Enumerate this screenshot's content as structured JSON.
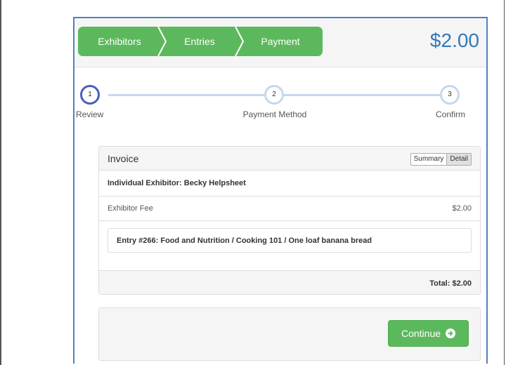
{
  "header": {
    "crumbs": [
      {
        "label": "Exhibitors"
      },
      {
        "label": "Entries"
      },
      {
        "label": "Payment"
      }
    ],
    "total": "$2.00"
  },
  "stepper": {
    "steps": [
      {
        "number": "1",
        "label": "Review",
        "active": true
      },
      {
        "number": "2",
        "label": "Payment Method",
        "active": false
      },
      {
        "number": "3",
        "label": "Confirm",
        "active": false
      }
    ]
  },
  "invoice": {
    "title": "Invoice",
    "view_toggle": {
      "summary": "Summary",
      "detail": "Detail",
      "selected": "Detail"
    },
    "exhibitor": "Individual Exhibitor: Becky Helpsheet",
    "fee": {
      "label": "Exhibitor Fee",
      "amount": "$2.00"
    },
    "entry": "Entry #266: Food and Nutrition / Cooking 101 / One loaf banana bread",
    "total": "Total: $2.00"
  },
  "actions": {
    "continue_label": "Continue",
    "continue_icon": "arrow-circle-right-icon"
  },
  "colors": {
    "accent_green": "#5cb85c",
    "price_blue": "#337ab7",
    "active_step": "#4a5dc0",
    "step_track": "#c5d8ee"
  }
}
